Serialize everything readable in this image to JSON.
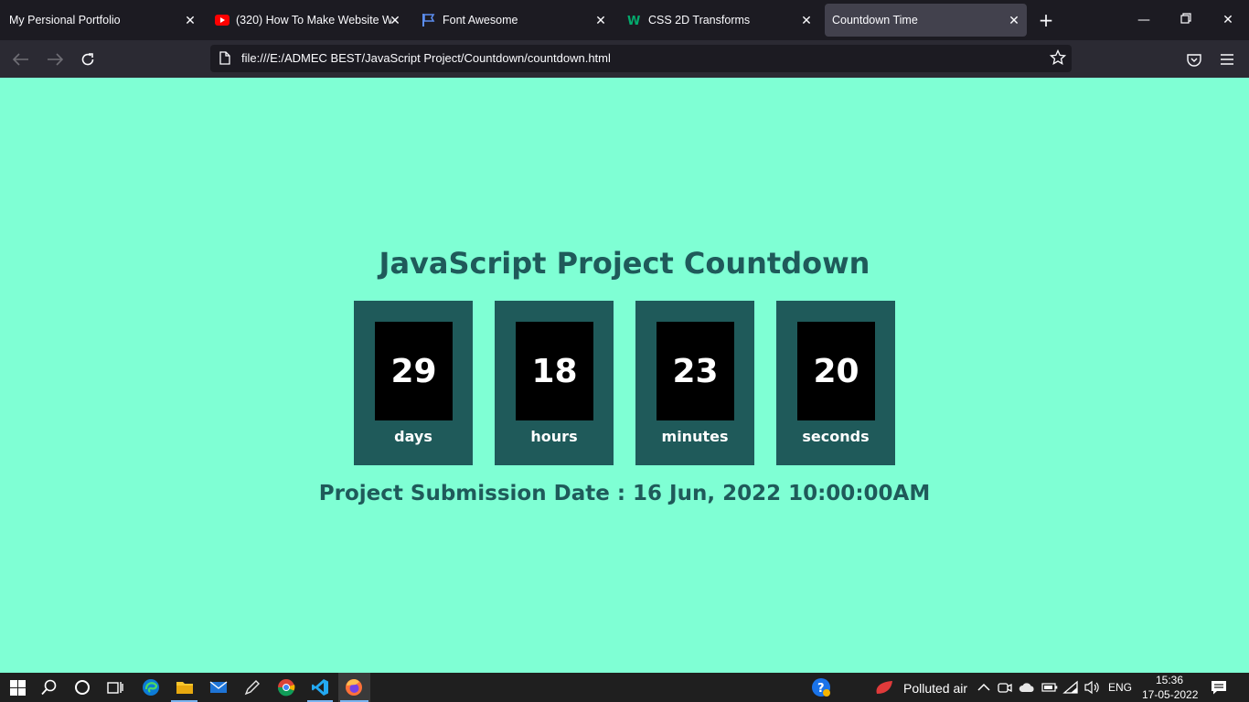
{
  "browser": {
    "tabs": [
      {
        "title": "My Persional Portfolio",
        "icon": "none"
      },
      {
        "title": "(320) How To Make Website Wit",
        "icon": "youtube-icon"
      },
      {
        "title": "Font Awesome",
        "icon": "flag-icon"
      },
      {
        "title": "CSS 2D Transforms",
        "icon": "w3schools-icon"
      },
      {
        "title": "Countdown Time",
        "icon": "none",
        "active": true
      }
    ],
    "url": "file:///E:/ADMEC BEST/JavaScript Project/Countdown/countdown.html"
  },
  "page": {
    "title": "JavaScript Project Countdown",
    "countdown": [
      {
        "value": "29",
        "unit": "days"
      },
      {
        "value": "18",
        "unit": "hours"
      },
      {
        "value": "23",
        "unit": "minutes"
      },
      {
        "value": "20",
        "unit": "seconds"
      }
    ],
    "submission": "Project Submission Date : 16 Jun, 2022 10:00:00AM"
  },
  "taskbar": {
    "weather": "Polluted air",
    "language": "ENG",
    "time": "15:36",
    "date": "17-05-2022"
  },
  "colors": {
    "page_bg": "#7fffd4",
    "accent": "#1f5a5a",
    "card": "#000000"
  }
}
